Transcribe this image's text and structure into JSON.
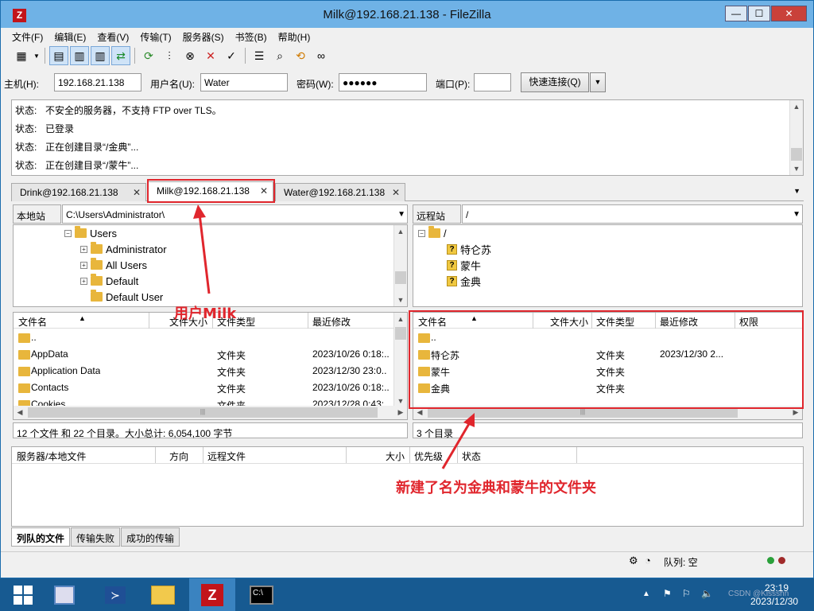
{
  "window": {
    "title": "Milk@192.168.21.138 - FileZilla",
    "minimize": "—",
    "maximize": "☐",
    "close": "✕"
  },
  "menu": [
    "文件(F)",
    "编辑(E)",
    "查看(V)",
    "传输(T)",
    "服务器(S)",
    "书签(B)",
    "帮助(H)"
  ],
  "quickconnect": {
    "host_label": "主机(H):",
    "host_value": "192.168.21.138",
    "user_label": "用户名(U):",
    "user_value": "Water",
    "pass_label": "密码(W):",
    "pass_value": "●●●●●●",
    "port_label": "端口(P):",
    "port_value": "",
    "button": "快速连接(Q)"
  },
  "log": [
    {
      "k": "状态:",
      "v": "不安全的服务器，不支持 FTP over TLS。"
    },
    {
      "k": "状态:",
      "v": "已登录"
    },
    {
      "k": "状态:",
      "v": "正在创建目录“/金典”..."
    },
    {
      "k": "状态:",
      "v": "正在创建目录“/蒙牛”..."
    }
  ],
  "tabs": [
    "Drink@192.168.21.138",
    "Milk@192.168.21.138",
    "Water@192.168.21.138"
  ],
  "local": {
    "site_label": "本地站点:",
    "path": "C:\\Users\\Administrator\\",
    "tree": [
      "Users",
      "Administrator",
      "All Users",
      "Default",
      "Default User"
    ],
    "headers": [
      "文件名",
      "文件大小",
      "文件类型",
      "最近修改"
    ],
    "files": [
      {
        "name": "..",
        "size": "",
        "type": "",
        "modified": ""
      },
      {
        "name": "AppData",
        "size": "",
        "type": "文件夹",
        "modified": "2023/10/26 0:18:.."
      },
      {
        "name": "Application Data",
        "size": "",
        "type": "文件夹",
        "modified": "2023/12/30 23:0.."
      },
      {
        "name": "Contacts",
        "size": "",
        "type": "文件夹",
        "modified": "2023/10/26 0:18:.."
      },
      {
        "name": "Cookies",
        "size": "",
        "type": "文件夹",
        "modified": "2023/12/28 0:43:.."
      }
    ],
    "status": "12 个文件 和 22 个目录。大小总计: 6,054,100 字节"
  },
  "remote": {
    "site_label": "远程站点:",
    "path": "/",
    "tree_root": "/",
    "tree": [
      "特仑苏",
      "蒙牛",
      "金典"
    ],
    "headers": [
      "文件名",
      "文件大小",
      "文件类型",
      "最近修改",
      "权限"
    ],
    "files": [
      {
        "name": "..",
        "type": "",
        "modified": ""
      },
      {
        "name": "特仑苏",
        "type": "文件夹",
        "modified": "2023/12/30 2..."
      },
      {
        "name": "蒙牛",
        "type": "文件夹",
        "modified": ""
      },
      {
        "name": "金典",
        "type": "文件夹",
        "modified": ""
      }
    ],
    "status": "3 个目录"
  },
  "queue": {
    "headers": [
      "服务器/本地文件",
      "方向",
      "远程文件",
      "大小",
      "优先级",
      "状态"
    ],
    "tabs": [
      "列队的文件",
      "传输失败",
      "成功的传输"
    ]
  },
  "statusbar": {
    "queue": "队列: 空"
  },
  "annotations": {
    "user": "用户Milk",
    "folders": "新建了名为金典和蒙牛的文件夹"
  },
  "taskbar": {
    "time": "23:19",
    "date": "2023/12/30",
    "watermark": "CSDN @Kissshn"
  }
}
